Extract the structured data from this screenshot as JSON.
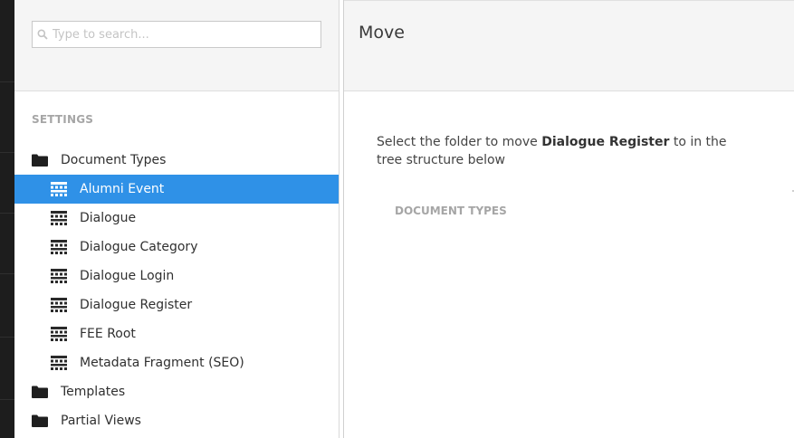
{
  "search": {
    "placeholder": "Type to search..."
  },
  "sidebar": {
    "section_label": "SETTINGS",
    "items": [
      {
        "label": "Document Types",
        "icon": "folder-icon",
        "level": "root",
        "selected": false
      },
      {
        "label": "Alumni Event",
        "icon": "document-type-icon",
        "level": "child",
        "selected": true
      },
      {
        "label": "Dialogue",
        "icon": "document-type-icon",
        "level": "child",
        "selected": false
      },
      {
        "label": "Dialogue Category",
        "icon": "document-type-icon",
        "level": "child",
        "selected": false
      },
      {
        "label": "Dialogue Login",
        "icon": "document-type-icon",
        "level": "child",
        "selected": false
      },
      {
        "label": "Dialogue Register",
        "icon": "document-type-icon",
        "level": "child",
        "selected": false
      },
      {
        "label": "FEE Root",
        "icon": "document-type-icon",
        "level": "child",
        "selected": false
      },
      {
        "label": "Metadata Fragment (SEO)",
        "icon": "document-type-icon",
        "level": "child",
        "selected": false
      },
      {
        "label": "Templates",
        "icon": "folder-icon",
        "level": "root",
        "selected": false
      },
      {
        "label": "Partial Views",
        "icon": "folder-icon",
        "level": "root",
        "selected": false
      }
    ]
  },
  "dialog": {
    "title": "Move",
    "instruction_before": "Select the folder to move ",
    "instruction_item": "Dialogue Register",
    "instruction_after": " to in the tree structure below",
    "destination_label": "DOCUMENT TYPES"
  },
  "colors": {
    "selected_row": "#2f91e7",
    "header_bg": "#f5f5f5",
    "muted_label": "#a6a6a6",
    "dark_chrome": "#1d1d1d"
  }
}
